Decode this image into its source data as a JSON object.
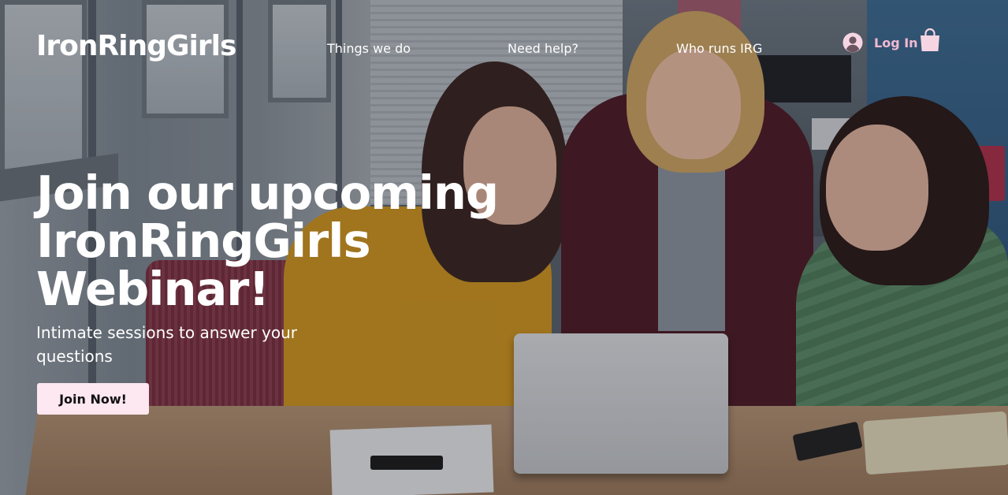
{
  "brand": {
    "logo": "IronRingGirls"
  },
  "nav": {
    "items": [
      {
        "label": "Things we do"
      },
      {
        "label": "Need help?"
      },
      {
        "label": "Who runs IRG"
      }
    ],
    "login_label": "Log In",
    "user_icon": "user-circle-icon",
    "cart_icon": "shopping-bag-icon"
  },
  "hero": {
    "headline_lines": [
      "Join our upcoming",
      "IronRingGirls",
      "Webinar!"
    ],
    "subline": "Intimate sessions to answer your questions",
    "cta_label": "Join Now!",
    "background": "photo of three young women looking at a laptop at an office table"
  },
  "colors": {
    "text": "#ffffff",
    "accent_pink": "#f3b9d2",
    "cta_bg": "#fde7f0",
    "cta_text": "#111111"
  }
}
